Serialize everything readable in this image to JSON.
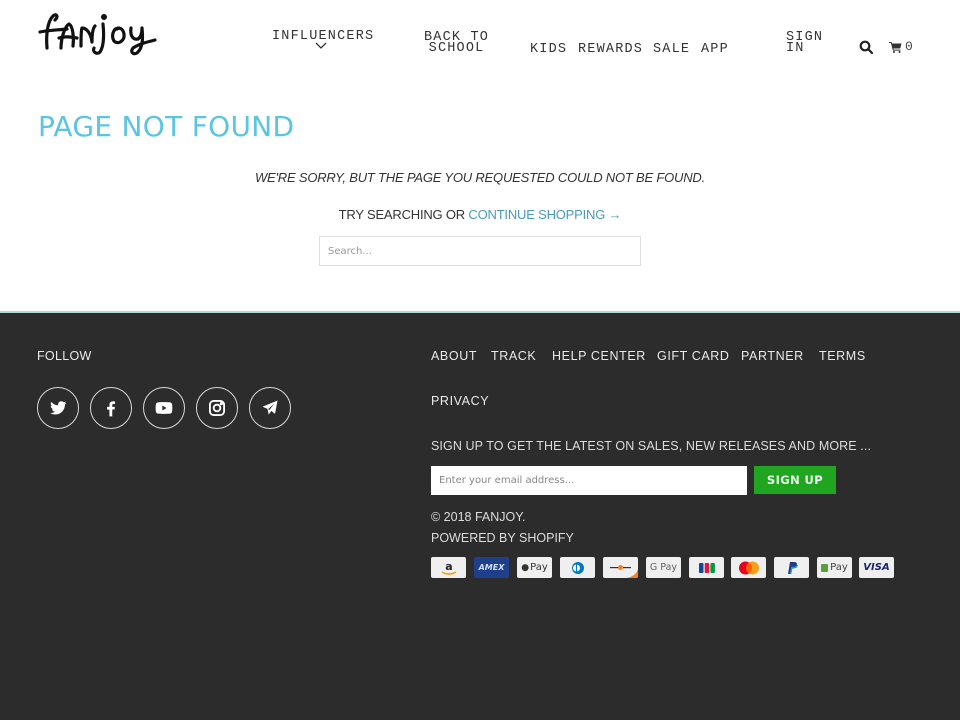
{
  "header": {
    "logo_text": "fanjoy",
    "nav": [
      {
        "label": "INFLUENCERS",
        "has_dropdown": true
      },
      {
        "label_line1": "BACK TO",
        "label_line2": "SCHOOL"
      },
      {
        "label": "KIDS"
      },
      {
        "label": "REWARDS"
      },
      {
        "label": "SALE"
      },
      {
        "label": "APP"
      },
      {
        "label_line1": "SIGN",
        "label_line2": "IN"
      }
    ],
    "icons": {
      "search": "search-icon",
      "cart": "cart-icon",
      "dropdown": "chevron-down-icon"
    },
    "cart_count": "0"
  },
  "main": {
    "title": "PAGE NOT FOUND",
    "sorry_text": "WE'RE SORRY, BUT THE PAGE YOU REQUESTED COULD NOT BE FOUND.",
    "try_text": "TRY SEARCHING OR ",
    "continue_link": "CONTINUE SHOPPING →",
    "search_placeholder": "Search...",
    "title_color": "#5bc4e2",
    "link_color": "#4a9bb5"
  },
  "footer": {
    "follow_label": "FOLLOW",
    "social": [
      "twitter-icon",
      "facebook-icon",
      "youtube-icon",
      "instagram-icon",
      "telegram-icon"
    ],
    "links": [
      "ABOUT",
      "TRACK",
      "HELP CENTER",
      "GIFT CARD",
      "PARTNER",
      "TERMS",
      "PRIVACY"
    ],
    "signup_text": "SIGN UP TO GET THE LATEST ON SALES, NEW RELEASES AND MORE ...",
    "email_placeholder": "Enter your email address...",
    "signup_button": "SIGN UP",
    "copyright": "© 2018 FANJOY.",
    "powered_by": "POWERED BY SHOPIFY",
    "payment_methods": [
      "Amazon",
      "American Express",
      "Apple Pay",
      "Diners Club",
      "Discover",
      "Google Pay",
      "JCB",
      "Mastercard",
      "PayPal",
      "Shop Pay",
      "Visa"
    ],
    "payment_labels": {
      "amex": "AMEX",
      "apple": "Pay",
      "google": "G Pay",
      "shop": "Pay",
      "visa": "VISA",
      "amazon": "a"
    },
    "button_color": "#1fa51f",
    "background_color": "#2c2c2c"
  }
}
